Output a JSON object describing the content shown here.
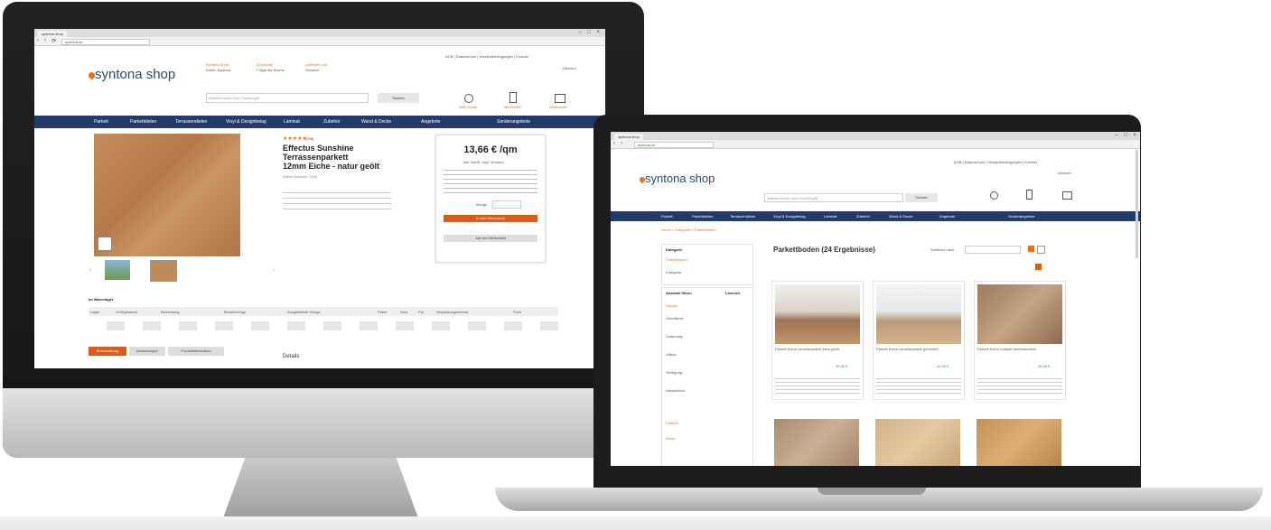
{
  "desktop": {
    "tab_title": "syntona shop",
    "url": "syntona.de",
    "logo": "syntona shop",
    "header_promos": [
      "Syntona Shop",
      "14 Monate",
      "Lieferzeit und",
      "Direkt, Syntona",
      "7 Tage die Woche",
      "Versand"
    ],
    "top_links": "AGB | Datenschutz | Versandbedingungen | Kontakt",
    "language": "Deutsch",
    "search_placeholder": "Artikelnummer oder Suchbegriff",
    "search_button": "Suchen",
    "header_icons": [
      "Mein Konto",
      "Merkzettel",
      "Warenkorb"
    ],
    "nav": [
      "Parkett",
      "Parkettdielen",
      "Terrassendielen",
      "Vinyl & Designbelag",
      "Laminat",
      "Zubehör",
      "Wand & Decke",
      "Angebote",
      "Sonderangebote"
    ],
    "product": {
      "stars": "★★★★★",
      "reviews": "(298)",
      "title_lines": [
        "Effectus Sunshine",
        "Terrassenparkett",
        "12mm Eiche - natur geölt"
      ],
      "article": "Artikel-Nummer 7990",
      "price": "13,66 € /qm",
      "price_note": "inkl. MwSt. zzgl. Versand",
      "qty_label": "Menge",
      "cart_button": "In den Warenkorb",
      "wishlist_button": "Auf den Merkzettel",
      "stock_heading": "Im Warenlager",
      "stock_columns": [
        "Lager",
        "Verfügbarkeit",
        "Bemerkung",
        "Bestellmenge",
        "Ausgelieferte Menge",
        "Paket",
        "Stck.",
        "Pal.",
        "Verpackungseinheit",
        "Preis"
      ],
      "tabs": [
        "Beschreibung",
        "Bewertungen",
        "Produktinformation"
      ],
      "section_title": "Details"
    }
  },
  "laptop": {
    "tab_title": "syntona shop",
    "url": "syntona.de",
    "logo": "syntona shop",
    "top_links": "AGB | Datenschutz | Versandbedingungen | Kontakt",
    "language": "Deutsch",
    "search_placeholder": "Artikelnummer oder Suchbegriff",
    "search_button": "Suchen",
    "nav": [
      "Parkett",
      "Parkettdielen",
      "Terrassendielen",
      "Vinyl & Designbelag",
      "Laminat",
      "Zubehör",
      "Wand & Decke",
      "Angebote",
      "Sonderangebote"
    ],
    "breadcrumb": "Home > Kategorie > Parkettboden",
    "category_heading": "Kategorie",
    "category_items": [
      "Parkettboden",
      "Kategorie"
    ],
    "filter_heading": "Auswahl filtern",
    "filter_reset": "Löschen",
    "filter_groups": [
      "Holzart",
      "Oberfläche",
      "Sortierung",
      "Stärke",
      "Verlegung",
      "Nutzschicht",
      "Farbton",
      "Breite"
    ],
    "results_title": "Parkettboden (24 Ergebnisse)",
    "sort_label": "Sortieren nach",
    "products": [
      {
        "name": "Parkett Eiche Landhausdiele natur geölt",
        "price": "39,90 €"
      },
      {
        "name": "Parkett Eiche Landhausdiele gebürstet",
        "price": "42,50 €"
      },
      {
        "name": "Parkett Eiche rustikal Landhausdiele",
        "price": "36,90 €"
      }
    ]
  },
  "colors": {
    "nav": "#243a6b",
    "accent": "#e8711a",
    "button": "#e05a14"
  }
}
